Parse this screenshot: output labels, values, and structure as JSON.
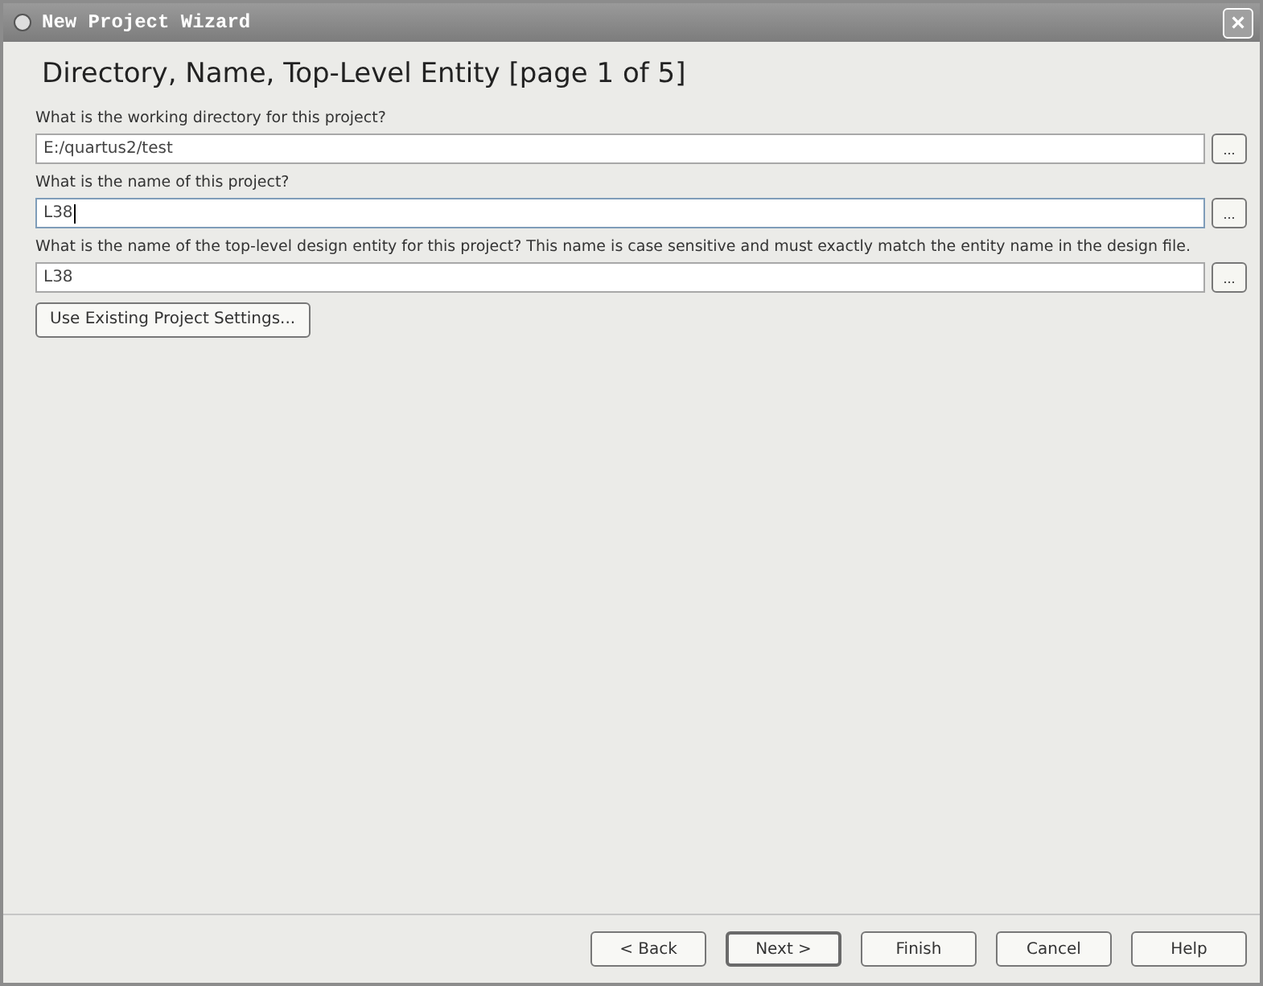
{
  "window": {
    "title": "New Project Wizard",
    "close": "×"
  },
  "heading": "Directory, Name, Top-Level Entity [page 1 of 5]",
  "fields": [
    {
      "label": "What is the working directory for this project?",
      "value": "E:/quartus2/test",
      "browse": "...",
      "focused": false
    },
    {
      "label": "What is the name of this project?",
      "value": "L38",
      "browse": "...",
      "focused": true
    },
    {
      "label": "What is the name of the top-level design entity for this project? This name is case sensitive and must exactly match the entity name in the design file.",
      "value": "L38",
      "browse": "...",
      "focused": false
    }
  ],
  "use_existing_button": "Use Existing Project Settings...",
  "buttons": [
    {
      "label": "< Back",
      "default": false
    },
    {
      "label": "Next >",
      "default": true
    },
    {
      "label": "Finish",
      "default": false
    },
    {
      "label": "Cancel",
      "default": false
    },
    {
      "label": "Help",
      "default": false
    }
  ]
}
